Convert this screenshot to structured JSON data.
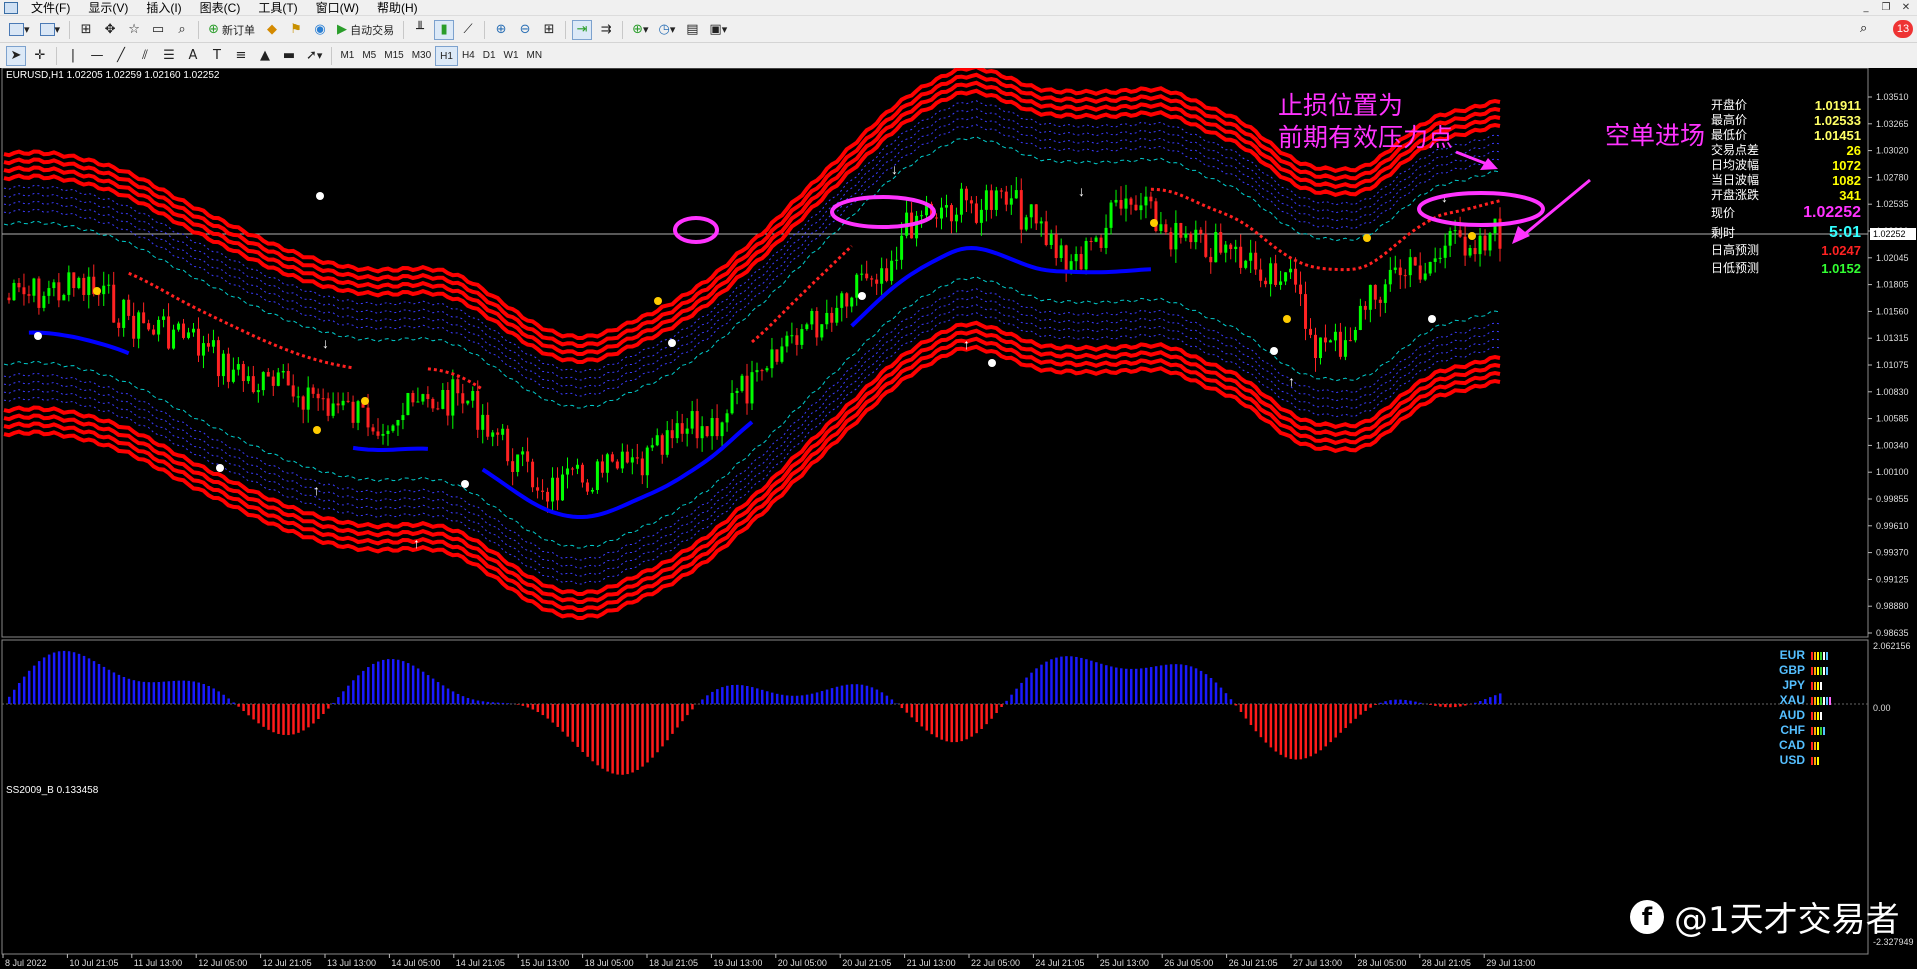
{
  "menu": {
    "items": [
      "文件(F)",
      "显示(V)",
      "插入(I)",
      "图表(C)",
      "工具(T)",
      "窗口(W)",
      "帮助(H)"
    ]
  },
  "toolbar": {
    "new_order_label": "新订单",
    "auto_trade_label": "自动交易",
    "notification_count": "13"
  },
  "timeframes": [
    "M1",
    "M5",
    "M15",
    "M30",
    "H1",
    "H4",
    "D1",
    "W1",
    "MN"
  ],
  "active_timeframe": "H1",
  "chart": {
    "title": "EURUSD,H1  1.02205 1.02259 1.02160 1.02252",
    "current_price_label": "1.02252",
    "price_axis": [
      "1.03510",
      "1.03265",
      "1.03020",
      "1.02780",
      "1.02535",
      "1.02290",
      "1.02045",
      "1.01805",
      "1.01560",
      "1.01315",
      "1.01075",
      "1.00830",
      "1.00585",
      "1.00340",
      "1.00100",
      "0.99855",
      "0.99610",
      "0.99370",
      "0.99125",
      "0.98880",
      "0.98635"
    ],
    "time_axis": [
      "8 Jul 2022",
      "10 Jul 21:05",
      "11 Jul 13:00",
      "12 Jul 05:00",
      "12 Jul 21:05",
      "13 Jul 13:00",
      "14 Jul 05:00",
      "14 Jul 21:05",
      "15 Jul 13:00",
      "18 Jul 05:00",
      "18 Jul 21:05",
      "19 Jul 13:00",
      "20 Jul 05:00",
      "20 Jul 21:05",
      "21 Jul 13:00",
      "22 Jul 05:00",
      "24 Jul 21:05",
      "25 Jul 13:00",
      "26 Jul 05:00",
      "26 Jul 21:05",
      "27 Jul 13:00",
      "28 Jul 05:00",
      "28 Jul 21:05",
      "29 Jul 13:00"
    ],
    "indicator_title": "SS2009_B 0.133458",
    "indicator_axis": [
      "2.062156",
      "0.00",
      "-2.327949"
    ]
  },
  "annotations": {
    "stop_loss_line1": "止损位置为",
    "stop_loss_line2": "前期有效压力点",
    "short_entry": "空单进场"
  },
  "info_panel": {
    "open": {
      "label": "开盘价",
      "value": "1.01911",
      "color": "#ffff66"
    },
    "high": {
      "label": "最高价",
      "value": "1.02533",
      "color": "#ffff66"
    },
    "low": {
      "label": "最低价",
      "value": "1.01451",
      "color": "#ffff66"
    },
    "spread": {
      "label": "交易点差",
      "value": "26",
      "color": "#ffff00"
    },
    "avg_range": {
      "label": "日均波幅",
      "value": "1072",
      "color": "#ffff00"
    },
    "today_range": {
      "label": "当日波幅",
      "value": "1082",
      "color": "#ffff00"
    },
    "open_change": {
      "label": "开盘涨跌",
      "value": "341",
      "color": "#ffff00"
    },
    "current": {
      "label": "现价",
      "value": "1.02252",
      "color": "#ff33ff"
    },
    "countdown": {
      "label": "剩时",
      "value": "5:01",
      "color": "#33ffff"
    },
    "high_forecast": {
      "label": "日高预测",
      "value": "1.0247",
      "color": "#ff2222"
    },
    "low_forecast": {
      "label": "日低预测",
      "value": "1.0152",
      "color": "#33ff33"
    }
  },
  "currency_strength": [
    {
      "code": "EUR",
      "bars": [
        "#ff2222",
        "#ffaa00",
        "#ffff00",
        "#33cc33",
        "#ffffff",
        "#55bfff"
      ]
    },
    {
      "code": "GBP",
      "bars": [
        "#ff2222",
        "#ffaa00",
        "#ffff00",
        "#33cc33",
        "#ffffff",
        "#55bfff"
      ]
    },
    {
      "code": "JPY",
      "bars": [
        "#ff2222",
        "#ffaa00",
        "#ffff00",
        "#ffffff"
      ]
    },
    {
      "code": "XAU",
      "bars": [
        "#ff2222",
        "#ffaa00",
        "#ffff00",
        "#33cc33",
        "#ffffff",
        "#55bfff",
        "#ff66ff"
      ]
    },
    {
      "code": "AUD",
      "bars": [
        "#ff2222",
        "#ffaa00",
        "#ffff00",
        "#ffffff"
      ]
    },
    {
      "code": "CHF",
      "bars": [
        "#ff2222",
        "#ffaa00",
        "#ffff00",
        "#33cc33",
        "#55bfff"
      ]
    },
    {
      "code": "CAD",
      "bars": [
        "#ff2222",
        "#ffaa00",
        "#ffff00"
      ]
    },
    {
      "code": "USD",
      "bars": [
        "#ff2222",
        "#ffaa00",
        "#ffff00"
      ]
    }
  ],
  "watermark": {
    "logo_letter": "f",
    "text": "@1天才交易者"
  },
  "colors": {
    "bull": "#00ff00",
    "bear": "#ff2222",
    "band": "#ff0000",
    "trend_up": "#0000ff",
    "trend_down": "#ff2020",
    "highlight": "#ff33ff"
  }
}
